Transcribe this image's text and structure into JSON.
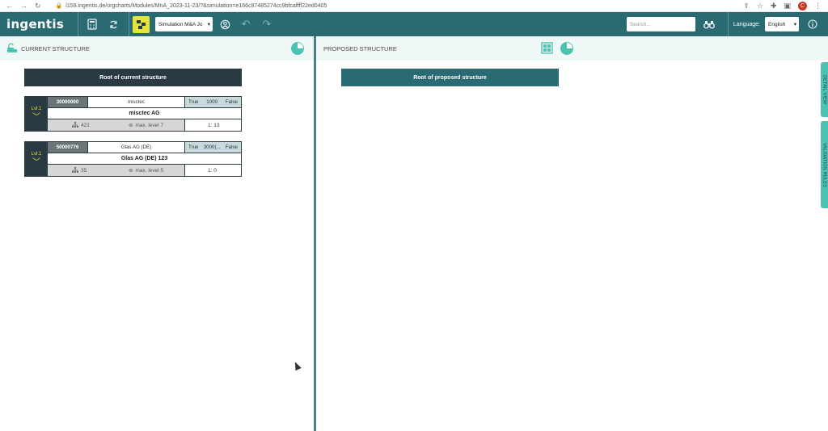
{
  "browser": {
    "url": "l159.ingentis.de/orgcharts/Modules/MnA_2023-11-23/?&simulation=e166c87485274cc9bfcaffff22ed0405",
    "profile_initial": "C"
  },
  "header": {
    "logo": "ingentis",
    "simulation_select": "Simulation M&A Jo",
    "search_placeholder": "Search...",
    "language_label": "Language:",
    "language_value": "English"
  },
  "left_panel": {
    "title": "CURRENT STRUCTURE",
    "root_label": "Root of current structure",
    "nodes": [
      {
        "level": "Lvl.1",
        "id": "30000000",
        "short_name": "misctec",
        "flag_true": "True",
        "flag_value": "1000",
        "flag_false": "False",
        "name": "misctec AG",
        "count": "421",
        "max_level": "max. level 7",
        "ratio": "1: 13"
      },
      {
        "level": "Lvl.1",
        "id": "50000776",
        "short_name": "Glas AG (DE)",
        "flag_true": "True",
        "flag_value": "3000(...",
        "flag_false": "False",
        "name": "Glas AG (DE) 123",
        "count": "35",
        "max_level": "max. level 5",
        "ratio": "1: 0"
      }
    ]
  },
  "right_panel": {
    "title": "PROPOSED STRUCTURE",
    "root_label": "Root of proposed structure"
  },
  "side_tabs": {
    "detail_view": "DETAIL VIEW",
    "validation_rules": "VALIDATION RULES"
  },
  "colors": {
    "header_bg": "#2a6a72",
    "accent_teal": "#4cc3b1",
    "accent_yellow": "#e2e63a",
    "dark_node": "#2a3a43"
  }
}
